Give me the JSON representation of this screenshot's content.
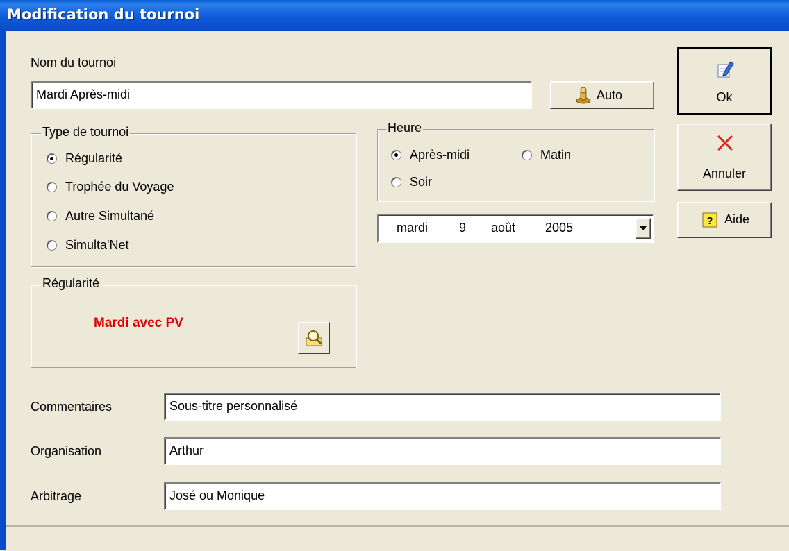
{
  "window": {
    "title": "Modification du tournoi"
  },
  "name_section": {
    "label": "Nom du tournoi",
    "value": "Mardi Après-midi",
    "auto_button": "Auto"
  },
  "tournament_type": {
    "title": "Type de tournoi",
    "options": [
      {
        "label": "Régularité",
        "selected": true
      },
      {
        "label": "Trophée du Voyage",
        "selected": false
      },
      {
        "label": "Autre Simultané",
        "selected": false
      },
      {
        "label": "Simulta'Net",
        "selected": false
      }
    ]
  },
  "time": {
    "title": "Heure",
    "options": [
      {
        "label": "Après-midi",
        "selected": true
      },
      {
        "label": "Matin",
        "selected": false
      },
      {
        "label": "Soir",
        "selected": false
      }
    ]
  },
  "date": {
    "weekday": "mardi",
    "day": "9",
    "month": "août",
    "year": "2005"
  },
  "regularity": {
    "title": "Régularité",
    "value": "Mardi avec PV",
    "value_color": "#e00000"
  },
  "buttons": {
    "ok": "Ok",
    "cancel": "Annuler",
    "help": "Aide"
  },
  "fields": {
    "comments": {
      "label": "Commentaires",
      "value": "Sous-titre personnalisé"
    },
    "organisation": {
      "label": "Organisation",
      "value": "Arthur"
    },
    "arbitrage": {
      "label": "Arbitrage",
      "value": "José ou Monique"
    }
  }
}
